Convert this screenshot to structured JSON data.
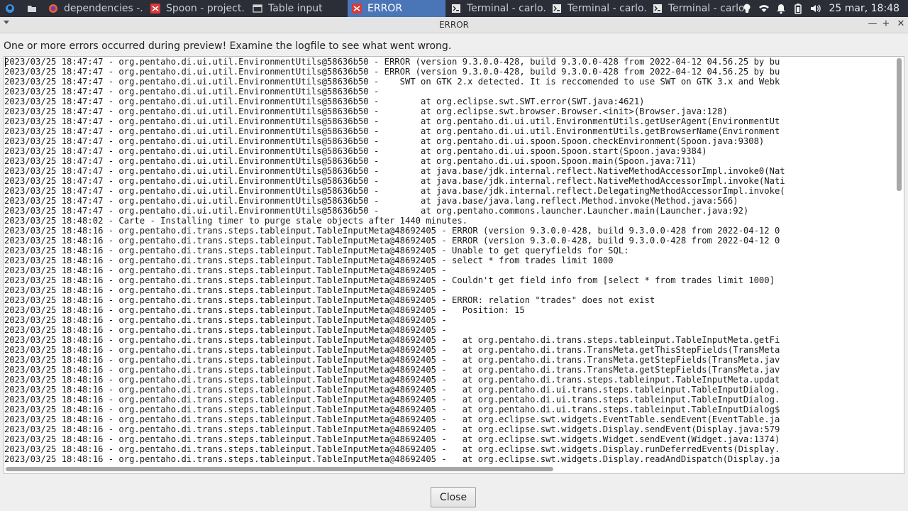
{
  "taskbar": {
    "items": [
      {
        "label": "dependencies -...",
        "icon": "firefox-icon",
        "active": false
      },
      {
        "label": "Spoon - project...",
        "icon": "pentaho-spoon-icon",
        "active": false
      },
      {
        "label": "Table input",
        "icon": "window-icon",
        "active": false
      },
      {
        "label": "ERROR",
        "icon": "pentaho-spoon-icon",
        "active": true
      },
      {
        "label": "Terminal - carlo...",
        "icon": "terminal-icon",
        "active": false
      },
      {
        "label": "Terminal - carlo...",
        "icon": "terminal-icon",
        "active": false
      },
      {
        "label": "Terminal - carlo...",
        "icon": "terminal-icon",
        "active": false
      }
    ],
    "tray_icons": [
      "lightbulb-icon",
      "wifi-icon",
      "bell-icon",
      "battery-icon",
      "volume-icon"
    ],
    "clock": "25 mar, 18:48"
  },
  "window": {
    "title": "ERROR",
    "message": "One or more errors occurred during preview!  Examine the logfile to see what went wrong.",
    "close_button": "Close"
  },
  "log": {
    "lines": [
      "2023/03/25 18:47:47 - org.pentaho.di.ui.util.EnvironmentUtils@58636b50 - ERROR (version 9.3.0.0-428, build 9.3.0.0-428 from 2022-04-12 04.56.25 by bu",
      "2023/03/25 18:47:47 - org.pentaho.di.ui.util.EnvironmentUtils@58636b50 - ERROR (version 9.3.0.0-428, build 9.3.0.0-428 from 2022-04-12 04.56.25 by bu",
      "2023/03/25 18:47:47 - org.pentaho.di.ui.util.EnvironmentUtils@58636b50 -    SWT on GTK 2.x detected. It is reccomended to use SWT on GTK 3.x and Webk",
      "2023/03/25 18:47:47 - org.pentaho.di.ui.util.EnvironmentUtils@58636b50 -",
      "2023/03/25 18:47:47 - org.pentaho.di.ui.util.EnvironmentUtils@58636b50 -        at org.eclipse.swt.SWT.error(SWT.java:4621)",
      "2023/03/25 18:47:47 - org.pentaho.di.ui.util.EnvironmentUtils@58636b50 -        at org.eclipse.swt.browser.Browser.<init>(Browser.java:128)",
      "2023/03/25 18:47:47 - org.pentaho.di.ui.util.EnvironmentUtils@58636b50 -        at org.pentaho.di.ui.util.EnvironmentUtils.getUserAgent(EnvironmentUt",
      "2023/03/25 18:47:47 - org.pentaho.di.ui.util.EnvironmentUtils@58636b50 -        at org.pentaho.di.ui.util.EnvironmentUtils.getBrowserName(Environment",
      "2023/03/25 18:47:47 - org.pentaho.di.ui.util.EnvironmentUtils@58636b50 -        at org.pentaho.di.ui.spoon.Spoon.checkEnvironment(Spoon.java:9308)",
      "2023/03/25 18:47:47 - org.pentaho.di.ui.util.EnvironmentUtils@58636b50 -        at org.pentaho.di.ui.spoon.Spoon.start(Spoon.java:9384)",
      "2023/03/25 18:47:47 - org.pentaho.di.ui.util.EnvironmentUtils@58636b50 -        at org.pentaho.di.ui.spoon.Spoon.main(Spoon.java:711)",
      "2023/03/25 18:47:47 - org.pentaho.di.ui.util.EnvironmentUtils@58636b50 -        at java.base/jdk.internal.reflect.NativeMethodAccessorImpl.invoke0(Nat",
      "2023/03/25 18:47:47 - org.pentaho.di.ui.util.EnvironmentUtils@58636b50 -        at java.base/jdk.internal.reflect.NativeMethodAccessorImpl.invoke(Nati",
      "2023/03/25 18:47:47 - org.pentaho.di.ui.util.EnvironmentUtils@58636b50 -        at java.base/jdk.internal.reflect.DelegatingMethodAccessorImpl.invoke(",
      "2023/03/25 18:47:47 - org.pentaho.di.ui.util.EnvironmentUtils@58636b50 -        at java.base/java.lang.reflect.Method.invoke(Method.java:566)",
      "2023/03/25 18:47:47 - org.pentaho.di.ui.util.EnvironmentUtils@58636b50 -        at org.pentaho.commons.launcher.Launcher.main(Launcher.java:92)",
      "2023/03/25 18:48:02 - Carte - Installing timer to purge stale objects after 1440 minutes.",
      "2023/03/25 18:48:16 - org.pentaho.di.trans.steps.tableinput.TableInputMeta@48692405 - ERROR (version 9.3.0.0-428, build 9.3.0.0-428 from 2022-04-12 0",
      "2023/03/25 18:48:16 - org.pentaho.di.trans.steps.tableinput.TableInputMeta@48692405 - ERROR (version 9.3.0.0-428, build 9.3.0.0-428 from 2022-04-12 0",
      "2023/03/25 18:48:16 - org.pentaho.di.trans.steps.tableinput.TableInputMeta@48692405 - Unable to get queryfields for SQL:",
      "2023/03/25 18:48:16 - org.pentaho.di.trans.steps.tableinput.TableInputMeta@48692405 - select * from trades limit 1000",
      "2023/03/25 18:48:16 - org.pentaho.di.trans.steps.tableinput.TableInputMeta@48692405 -",
      "2023/03/25 18:48:16 - org.pentaho.di.trans.steps.tableinput.TableInputMeta@48692405 - Couldn't get field info from [select * from trades limit 1000]",
      "2023/03/25 18:48:16 - org.pentaho.di.trans.steps.tableinput.TableInputMeta@48692405 -",
      "2023/03/25 18:48:16 - org.pentaho.di.trans.steps.tableinput.TableInputMeta@48692405 - ERROR: relation \"trades\" does not exist",
      "2023/03/25 18:48:16 - org.pentaho.di.trans.steps.tableinput.TableInputMeta@48692405 -   Position: 15",
      "2023/03/25 18:48:16 - org.pentaho.di.trans.steps.tableinput.TableInputMeta@48692405 -",
      "2023/03/25 18:48:16 - org.pentaho.di.trans.steps.tableinput.TableInputMeta@48692405 -",
      "2023/03/25 18:48:16 - org.pentaho.di.trans.steps.tableinput.TableInputMeta@48692405 -   at org.pentaho.di.trans.steps.tableinput.TableInputMeta.getFi",
      "2023/03/25 18:48:16 - org.pentaho.di.trans.steps.tableinput.TableInputMeta@48692405 -   at org.pentaho.di.trans.TransMeta.getThisStepFields(TransMeta",
      "2023/03/25 18:48:16 - org.pentaho.di.trans.steps.tableinput.TableInputMeta@48692405 -   at org.pentaho.di.trans.TransMeta.getStepFields(TransMeta.jav",
      "2023/03/25 18:48:16 - org.pentaho.di.trans.steps.tableinput.TableInputMeta@48692405 -   at org.pentaho.di.trans.TransMeta.getStepFields(TransMeta.jav",
      "2023/03/25 18:48:16 - org.pentaho.di.trans.steps.tableinput.TableInputMeta@48692405 -   at org.pentaho.di.trans.steps.tableinput.TableInputMeta.updat",
      "2023/03/25 18:48:16 - org.pentaho.di.trans.steps.tableinput.TableInputMeta@48692405 -   at org.pentaho.di.ui.trans.steps.tableinput.TableInputDialog.",
      "2023/03/25 18:48:16 - org.pentaho.di.trans.steps.tableinput.TableInputMeta@48692405 -   at org.pentaho.di.ui.trans.steps.tableinput.TableInputDialog.",
      "2023/03/25 18:48:16 - org.pentaho.di.trans.steps.tableinput.TableInputMeta@48692405 -   at org.pentaho.di.ui.trans.steps.tableinput.TableInputDialog$",
      "2023/03/25 18:48:16 - org.pentaho.di.trans.steps.tableinput.TableInputMeta@48692405 -   at org.eclipse.swt.widgets.EventTable.sendEvent(EventTable.ja",
      "2023/03/25 18:48:16 - org.pentaho.di.trans.steps.tableinput.TableInputMeta@48692405 -   at org.eclipse.swt.widgets.Display.sendEvent(Display.java:579",
      "2023/03/25 18:48:16 - org.pentaho.di.trans.steps.tableinput.TableInputMeta@48692405 -   at org.eclipse.swt.widgets.Widget.sendEvent(Widget.java:1374)",
      "2023/03/25 18:48:16 - org.pentaho.di.trans.steps.tableinput.TableInputMeta@48692405 -   at org.eclipse.swt.widgets.Display.runDeferredEvents(Display.",
      "2023/03/25 18:48:16 - org.pentaho.di.trans.steps.tableinput.TableInputMeta@48692405 -   at org.eclipse.swt.widgets.Display.readAndDispatch(Display.ja"
    ]
  },
  "colors": {
    "taskbar_bg": "#2b2e37",
    "active_task_bg": "#4a76b8",
    "pentaho_red": "#d93a3a"
  }
}
